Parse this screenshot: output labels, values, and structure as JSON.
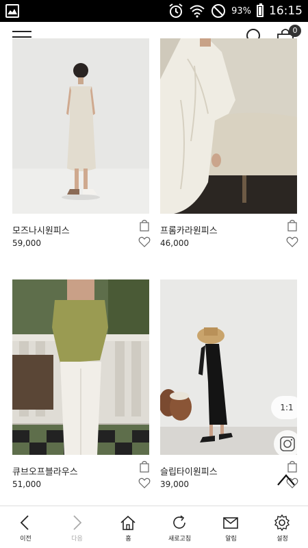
{
  "status_bar": {
    "battery": "93%",
    "time": "16:15",
    "icons": [
      "gallery-icon",
      "alarm-icon",
      "wifi-icon",
      "no-disturb-icon",
      "battery-icon"
    ]
  },
  "header": {
    "icons": [
      "menu-icon",
      "search-icon",
      "shopping-bag-icon"
    ],
    "cart_count": "0"
  },
  "products": [
    {
      "name": "모즈나시원피스",
      "price": "59,000"
    },
    {
      "name": "프롬카라원피스",
      "price": "46,000"
    },
    {
      "name": "큐브오프블라우스",
      "price": "51,000"
    },
    {
      "name": "슬립타이원피스",
      "price": "39,000"
    }
  ],
  "floating": {
    "ratio_label": "1:1",
    "icons": [
      "instagram-icon",
      "scroll-top-icon"
    ]
  },
  "bottom_nav": [
    {
      "label": "이전",
      "icon": "back-arrow-icon"
    },
    {
      "label": "다음",
      "icon": "forward-arrow-icon"
    },
    {
      "label": "홈",
      "icon": "home-icon"
    },
    {
      "label": "새로고침",
      "icon": "refresh-icon"
    },
    {
      "label": "알림",
      "icon": "mail-icon"
    },
    {
      "label": "설정",
      "icon": "settings-icon"
    }
  ]
}
